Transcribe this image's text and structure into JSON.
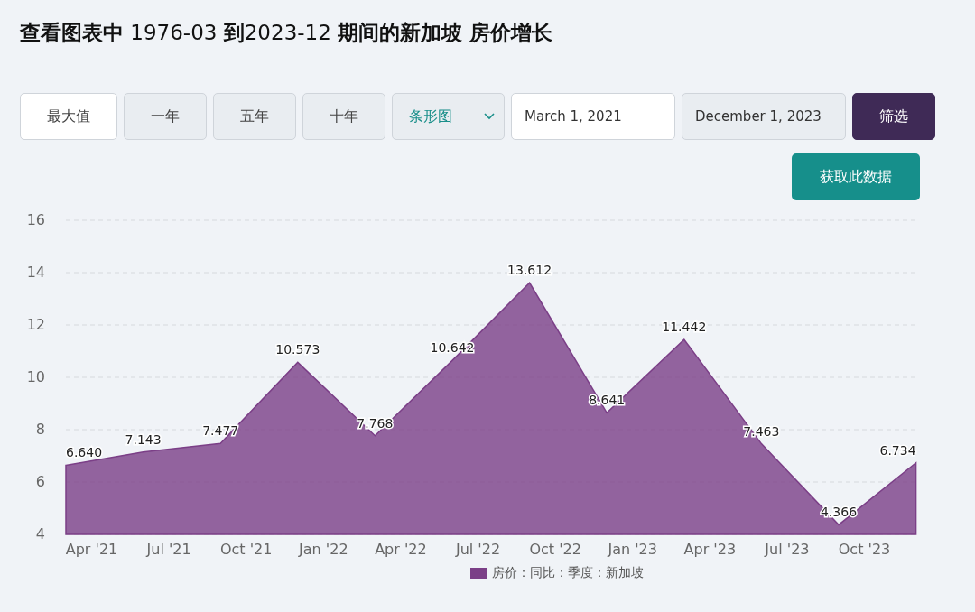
{
  "title": "**查看图表中** 1976-03 **到**2023-12 **期间的新加坡 房价增长**",
  "range_buttons": [
    {
      "label": "最大值",
      "selected": true
    },
    {
      "label": "一年",
      "selected": false
    },
    {
      "label": "五年",
      "selected": false
    },
    {
      "label": "十年",
      "selected": false
    }
  ],
  "chart_type": {
    "value": "条形图"
  },
  "start_date": {
    "value": "March 1, 2021"
  },
  "end_date": {
    "value": "December 1, 2023"
  },
  "filter_button": "筛选",
  "get_data_button": "获取此数据",
  "chart": {
    "chart_data": {
      "type": "area",
      "x": [
        "2021-03-01",
        "2021-06-01",
        "2021-09-01",
        "2021-12-01",
        "2022-03-01",
        "2022-06-01",
        "2022-09-01",
        "2022-12-01",
        "2023-03-01",
        "2023-06-01",
        "2023-09-01",
        "2023-12-01"
      ],
      "series": [
        {
          "name": "房价：同比：季度：新加坡",
          "color": "#7b3f87",
          "values": [
            6.64,
            7.143,
            7.477,
            10.573,
            7.768,
            10.642,
            13.612,
            8.641,
            11.442,
            7.463,
            4.366,
            6.734
          ]
        }
      ],
      "xlim": [
        "2021-03-01",
        "2023-12-01"
      ],
      "grid": true,
      "ylim": [
        4,
        16
      ],
      "yticks": [
        4,
        6,
        8,
        10,
        12,
        14,
        16
      ],
      "xticks": [
        {
          "value": "2021-04-01",
          "label": "Apr '21"
        },
        {
          "value": "2021-07-01",
          "label": "Jul '21"
        },
        {
          "value": "2021-10-01",
          "label": "Oct '21"
        },
        {
          "value": "2022-01-01",
          "label": "Jan '22"
        },
        {
          "value": "2022-04-01",
          "label": "Apr '22"
        },
        {
          "value": "2022-07-01",
          "label": "Jul '22"
        },
        {
          "value": "2022-10-01",
          "label": "Oct '22"
        },
        {
          "value": "2023-01-01",
          "label": "Jan '23"
        },
        {
          "value": "2023-04-01",
          "label": "Apr '23"
        },
        {
          "value": "2023-07-01",
          "label": "Jul '23"
        },
        {
          "value": "2023-10-01",
          "label": "Oct '23"
        }
      ],
      "value_labels": [
        "6.640",
        "7.143",
        "7.477",
        "10.573",
        "7.768",
        "10.642",
        "13.612",
        "8.641",
        "11.442",
        "7.463",
        "4.366",
        "6.734"
      ]
    }
  }
}
